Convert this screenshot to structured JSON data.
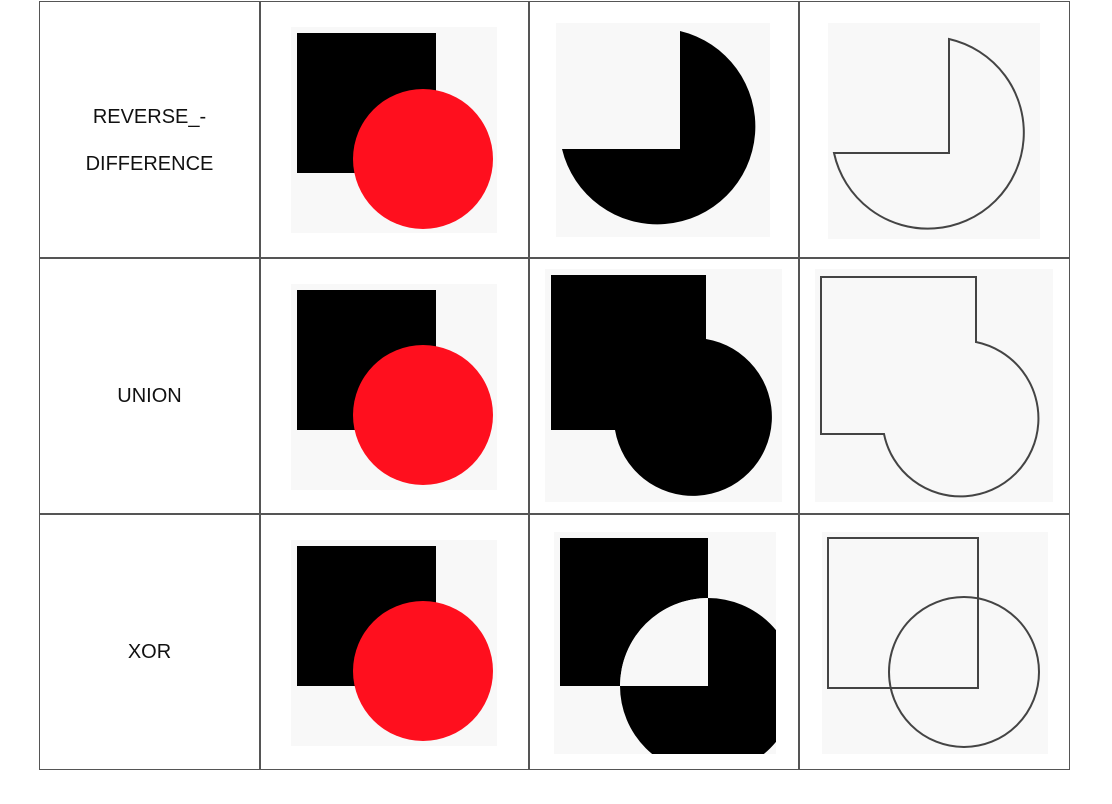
{
  "rows": [
    {
      "label_line1": "REVERSE_-",
      "label_line2": "DIFFERENCE",
      "operation": "reverse_difference"
    },
    {
      "label": "UNION",
      "operation": "union"
    },
    {
      "label": "XOR",
      "operation": "xor"
    }
  ],
  "colors": {
    "square": "#000000",
    "circle": "#ff0f1e",
    "panel_bg": "#f8f8f8",
    "outline": "#444444",
    "grid": "#555555"
  }
}
